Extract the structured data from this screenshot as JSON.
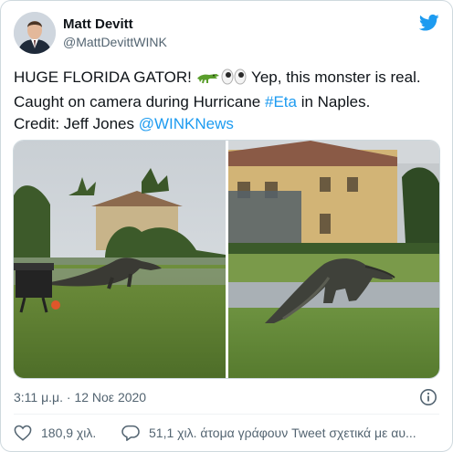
{
  "author": {
    "display_name": "Matt Devitt",
    "handle": "@MattDevittWINK"
  },
  "tweet": {
    "line1": "HUGE FLORIDA GATOR! ",
    "line1_tail": " Yep, this monster is real.",
    "line2_pre": "Caught on camera during Hurricane ",
    "hashtag": "#Eta",
    "line2_post": " in Naples.",
    "line3_pre": "Credit: Jeff Jones ",
    "mention": "@WINKNews"
  },
  "media": {
    "photos": [
      "gator-on-golf-course-wide",
      "gator-on-golf-course-close"
    ]
  },
  "meta": {
    "timestamp": "3:11 μ.μ. · 12 Νοε 2020"
  },
  "actions": {
    "likes": "180,9 χιλ.",
    "reply_label": "51,1 χιλ. άτομα γράφουν Tweet σχετικά με αυ..."
  },
  "colors": {
    "accent": "#1d9bf0",
    "like_heart": "#536471"
  }
}
